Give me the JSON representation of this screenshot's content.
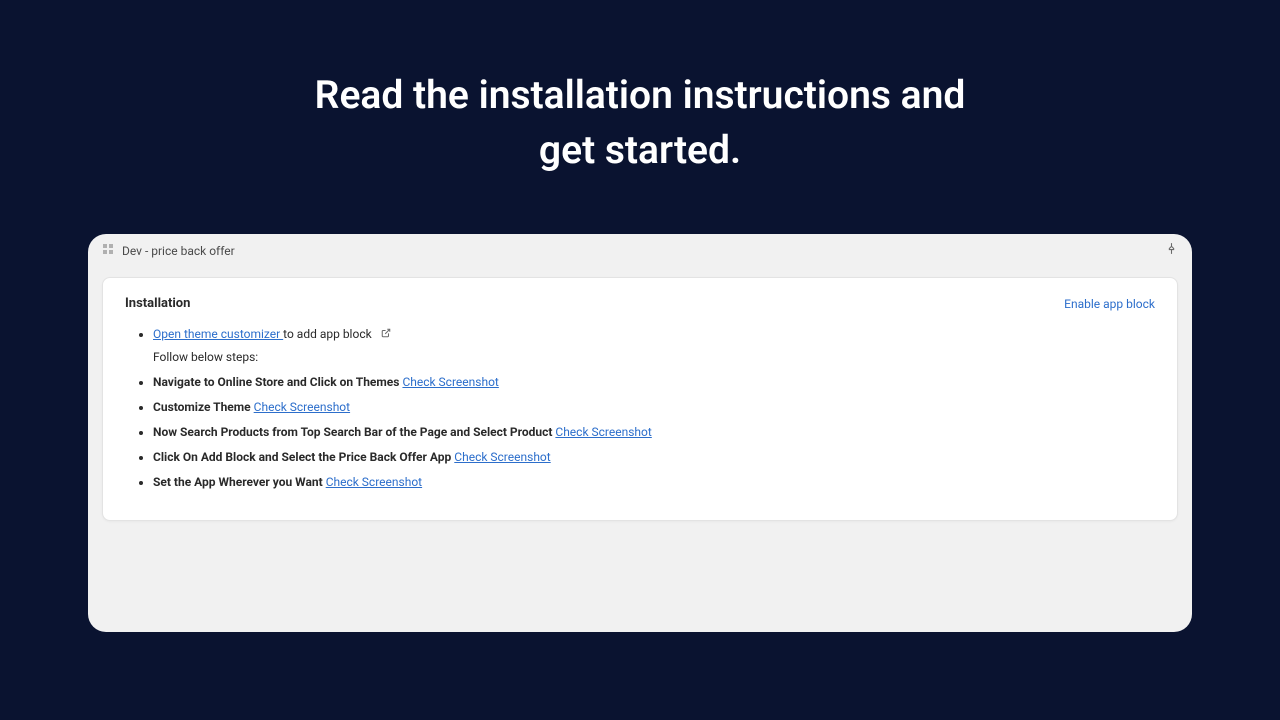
{
  "page": {
    "title_line1": "Read the installation instructions and",
    "title_line2": "get started."
  },
  "header": {
    "app_title": "Dev - price back offer"
  },
  "card": {
    "title": "Installation",
    "enable_link": "Enable app block"
  },
  "steps": {
    "open_customizer": "Open theme customizer ",
    "open_customizer_suffix": "to add app block",
    "follow": "Follow below steps:",
    "s1": "Navigate to Online Store and Click on Themes",
    "s2": "Customize Theme",
    "s3": "Now Search Products from Top Search Bar of the Page and Select Product",
    "s4": "Click On Add Block and Select the Price Back Offer App",
    "s5": "Set the App Wherever you Want",
    "check": "Check Screenshot"
  }
}
